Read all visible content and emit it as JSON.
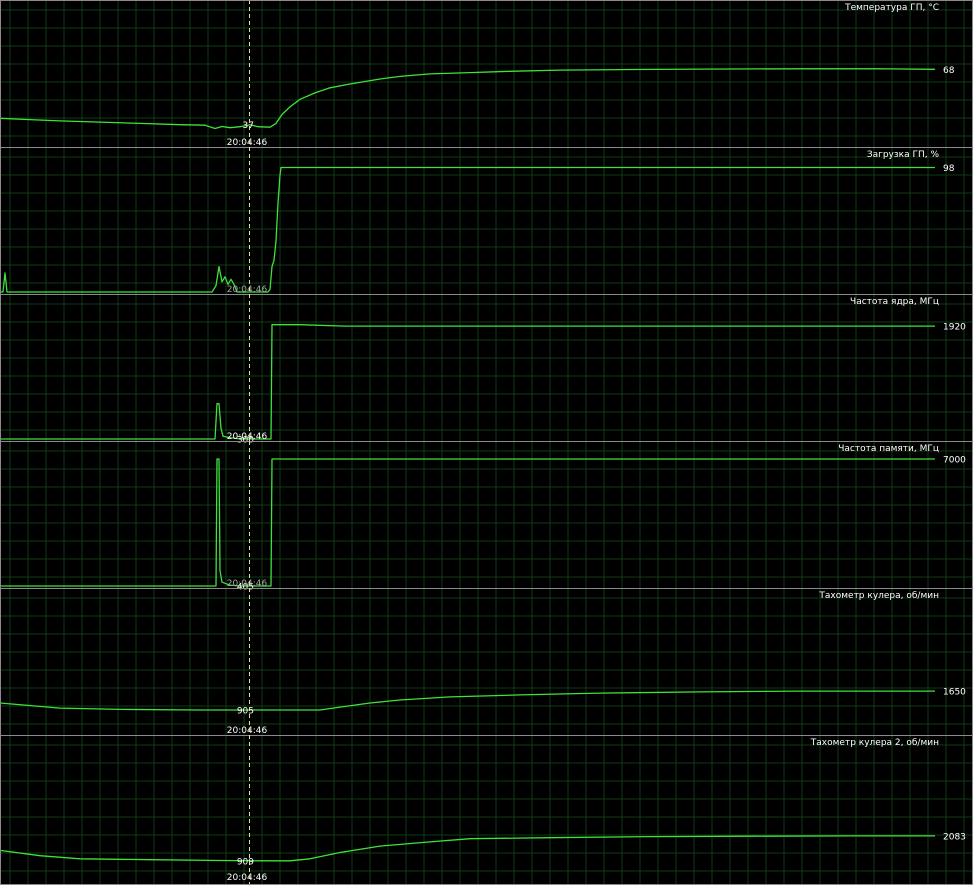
{
  "cursor": {
    "time_label": "20:04:46"
  },
  "colors": {
    "background": "#000000",
    "grid": "#0f3a12",
    "trace": "#3ee23a",
    "text": "#ffffff",
    "text_dim": "#a8a8a8",
    "cursor_line": "#e8e08a",
    "separator": "#8a8a8a"
  },
  "graphs": [
    {
      "title": "Температура ГП, °C",
      "current_value": "68",
      "cursor_value": "37",
      "ylim": [
        30,
        80
      ],
      "points": [
        [
          0,
          40.5
        ],
        [
          30,
          40
        ],
        [
          60,
          39.5
        ],
        [
          100,
          39
        ],
        [
          140,
          38.5
        ],
        [
          180,
          38
        ],
        [
          205,
          37.8
        ],
        [
          215,
          36.5
        ],
        [
          222,
          37.3
        ],
        [
          230,
          36.8
        ],
        [
          240,
          37.2
        ],
        [
          250,
          38
        ],
        [
          258,
          37.2
        ],
        [
          270,
          37
        ],
        [
          276,
          38.5
        ],
        [
          282,
          42
        ],
        [
          290,
          45
        ],
        [
          300,
          48
        ],
        [
          315,
          50.5
        ],
        [
          330,
          52.5
        ],
        [
          350,
          54
        ],
        [
          380,
          56
        ],
        [
          400,
          57
        ],
        [
          430,
          58
        ],
        [
          470,
          58.5
        ],
        [
          510,
          59
        ],
        [
          560,
          59.5
        ],
        [
          620,
          59.7
        ],
        [
          700,
          59.9
        ],
        [
          800,
          60
        ],
        [
          880,
          60
        ],
        [
          935,
          59.8
        ]
      ]
    },
    {
      "title": "Загрузка ГП, %",
      "current_value": "98",
      "cursor_value": "",
      "ylim": [
        0,
        100
      ],
      "points": [
        [
          0,
          0
        ],
        [
          3,
          0
        ],
        [
          5,
          15
        ],
        [
          7,
          0
        ],
        [
          60,
          0
        ],
        [
          130,
          0
        ],
        [
          200,
          0
        ],
        [
          212,
          0
        ],
        [
          216,
          5
        ],
        [
          219,
          20
        ],
        [
          222,
          8
        ],
        [
          225,
          12
        ],
        [
          228,
          6
        ],
        [
          231,
          10
        ],
        [
          234,
          6
        ],
        [
          237,
          0
        ],
        [
          262,
          0
        ],
        [
          268,
          0
        ],
        [
          270,
          2
        ],
        [
          272,
          20
        ],
        [
          274,
          25
        ],
        [
          276,
          40
        ],
        [
          278,
          70
        ],
        [
          280,
          92
        ],
        [
          281,
          98
        ],
        [
          320,
          98
        ],
        [
          400,
          98
        ],
        [
          500,
          98
        ],
        [
          600,
          98
        ],
        [
          700,
          98
        ],
        [
          800,
          98
        ],
        [
          935,
          98
        ]
      ]
    },
    {
      "title": "Частота ядра, МГц",
      "current_value": "1920",
      "cursor_value": "300",
      "ylim": [
        300,
        2100
      ],
      "points": [
        [
          0,
          300
        ],
        [
          100,
          300
        ],
        [
          200,
          300
        ],
        [
          215,
          300
        ],
        [
          217,
          800
        ],
        [
          219,
          800
        ],
        [
          221,
          450
        ],
        [
          223,
          340
        ],
        [
          230,
          320
        ],
        [
          240,
          300
        ],
        [
          271,
          300
        ],
        [
          272,
          1920
        ],
        [
          300,
          1920
        ],
        [
          345,
          1900
        ],
        [
          400,
          1900
        ],
        [
          500,
          1900
        ],
        [
          600,
          1900
        ],
        [
          700,
          1900
        ],
        [
          800,
          1900
        ],
        [
          935,
          1900
        ]
      ]
    },
    {
      "title": "Частота памяти, МГц",
      "current_value": "7000",
      "cursor_value": "405",
      "ylim": [
        405,
        7000
      ],
      "points": [
        [
          0,
          405
        ],
        [
          100,
          405
        ],
        [
          200,
          405
        ],
        [
          216,
          405
        ],
        [
          217,
          7000
        ],
        [
          219,
          7000
        ],
        [
          220,
          1200
        ],
        [
          222,
          600
        ],
        [
          230,
          450
        ],
        [
          240,
          405
        ],
        [
          271,
          405
        ],
        [
          272,
          7000
        ],
        [
          400,
          7000
        ],
        [
          500,
          7000
        ],
        [
          600,
          7000
        ],
        [
          700,
          7000
        ],
        [
          800,
          7000
        ],
        [
          935,
          7000
        ]
      ]
    },
    {
      "title": "Тахометр кулера, об/мин",
      "current_value": "1650",
      "cursor_value": "905",
      "ylim": [
        0,
        5000
      ],
      "points": [
        [
          0,
          1180
        ],
        [
          60,
          980
        ],
        [
          120,
          930
        ],
        [
          200,
          905
        ],
        [
          250,
          905
        ],
        [
          300,
          905
        ],
        [
          320,
          905
        ],
        [
          340,
          1020
        ],
        [
          370,
          1180
        ],
        [
          400,
          1300
        ],
        [
          450,
          1420
        ],
        [
          520,
          1500
        ],
        [
          600,
          1570
        ],
        [
          700,
          1620
        ],
        [
          800,
          1650
        ],
        [
          935,
          1650
        ]
      ]
    },
    {
      "title": "Тахометр кулера 2, об/мин",
      "current_value": "2083",
      "cursor_value": "909",
      "ylim": [
        0,
        6000
      ],
      "points": [
        [
          0,
          1400
        ],
        [
          40,
          1150
        ],
        [
          80,
          1000
        ],
        [
          150,
          960
        ],
        [
          220,
          920
        ],
        [
          260,
          909
        ],
        [
          290,
          909
        ],
        [
          310,
          1000
        ],
        [
          340,
          1300
        ],
        [
          380,
          1600
        ],
        [
          430,
          1800
        ],
        [
          470,
          1950
        ],
        [
          550,
          2000
        ],
        [
          650,
          2050
        ],
        [
          750,
          2070
        ],
        [
          850,
          2083
        ],
        [
          935,
          2083
        ]
      ]
    }
  ]
}
